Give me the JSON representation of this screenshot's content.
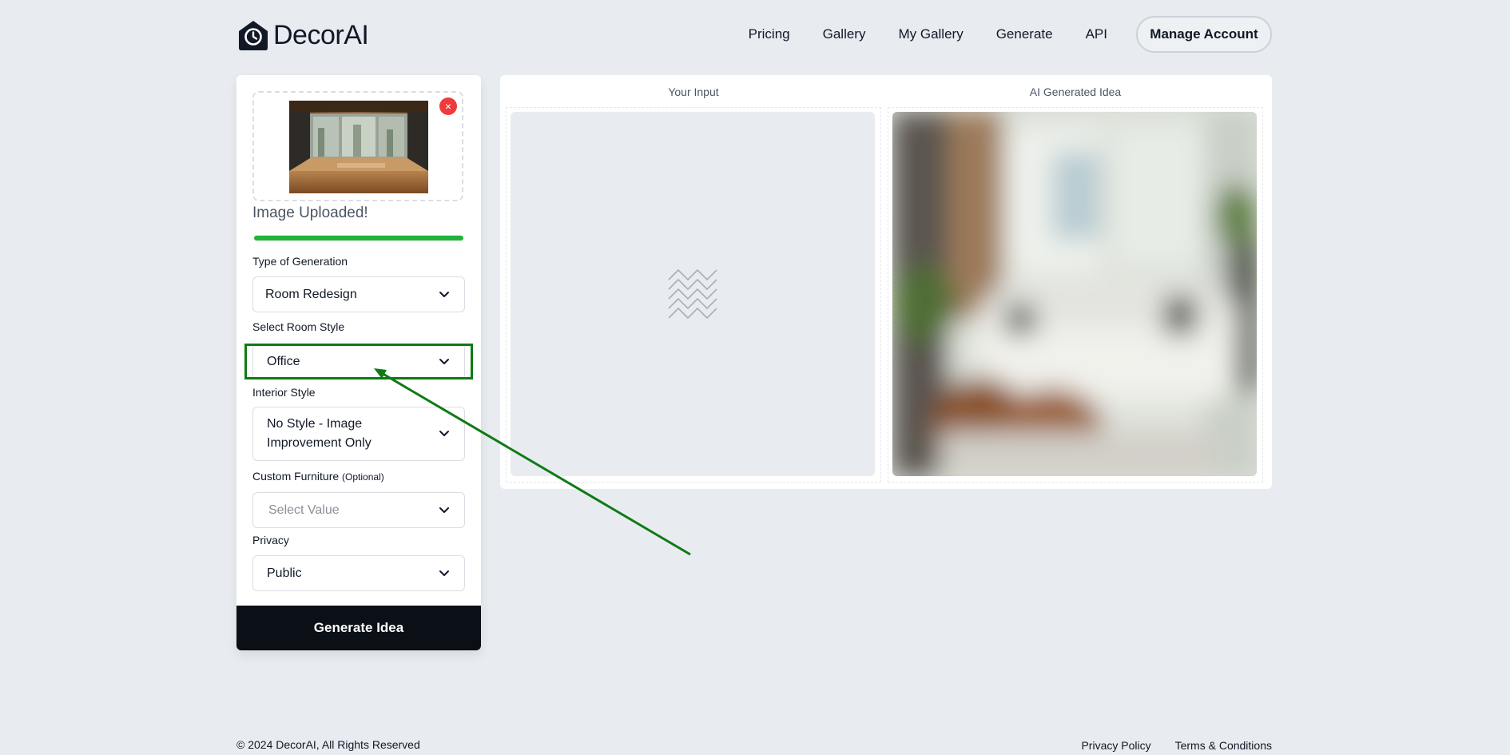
{
  "header": {
    "logo_text": "DecorAI",
    "nav": [
      "Pricing",
      "Gallery",
      "My Gallery",
      "Generate",
      "API"
    ],
    "manage_account": "Manage Account"
  },
  "form": {
    "upload_status": "Image Uploaded!",
    "upload_progress_percent": 100,
    "remove_icon": "×",
    "type_label": "Type of Generation",
    "type_value": "Room Redesign",
    "room_style_label": "Select Room Style",
    "room_style_value": "Office",
    "interior_label": "Interior Style",
    "interior_value": "No Style - Image Improvement Only",
    "furniture_label": "Custom Furniture",
    "furniture_optional": "(Optional)",
    "furniture_placeholder": "Select Value",
    "privacy_label": "Privacy",
    "privacy_value": "Public",
    "generate_button": "Generate Idea"
  },
  "compare": {
    "input_title": "Your Input",
    "output_title": "AI Generated Idea"
  },
  "footer": {
    "copyright": "© 2024 DecorAI, All Rights Reserved",
    "privacy": "Privacy Policy",
    "terms": "Terms & Conditions"
  },
  "colors": {
    "background": "#e8ecf0",
    "primary_dark": "#0b0f16",
    "progress_green": "#22b33a",
    "remove_red": "#ef3b3b",
    "annotation_green": "#0f7a14"
  }
}
